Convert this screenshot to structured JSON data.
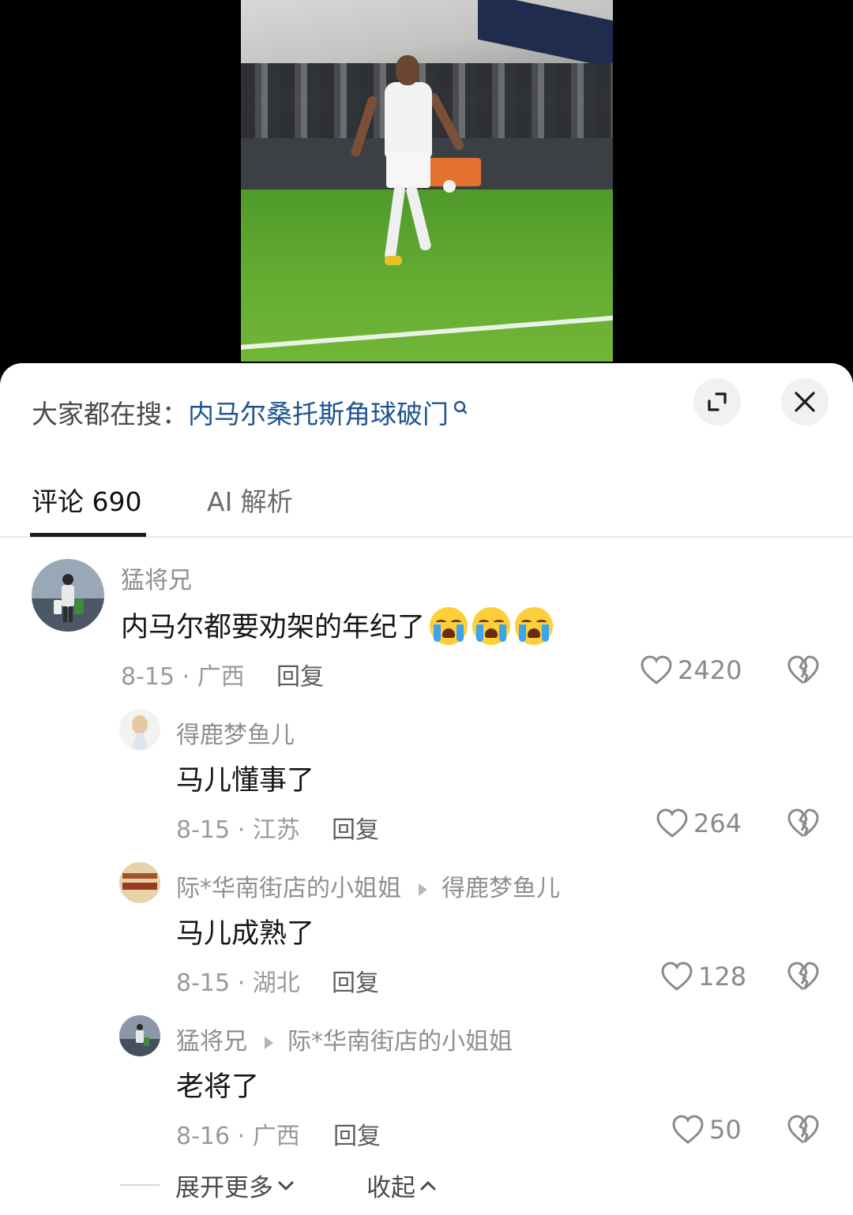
{
  "search": {
    "prefix": "大家都在搜：",
    "term": "内马尔桑托斯角球破门"
  },
  "tabs": [
    {
      "label": "评论 690"
    },
    {
      "label": "AI 解析"
    }
  ],
  "comments": [
    {
      "username": "猛将兄",
      "content": "内马尔都要劝架的年纪了",
      "emoji": "loudly-crying-face",
      "emoji_count": 3,
      "meta": "8-15 · 广西",
      "reply_label": "回复",
      "likes": "2420"
    },
    {
      "username": "得鹿梦鱼儿",
      "content": "马儿懂事了",
      "meta": "8-15 · 江苏",
      "reply_label": "回复",
      "likes": "264"
    },
    {
      "username": "际*华南街店的小姐姐",
      "reply_to": "得鹿梦鱼儿",
      "content": "马儿成熟了",
      "meta": "8-15 · 湖北",
      "reply_label": "回复",
      "likes": "128"
    },
    {
      "username": "猛将兄",
      "reply_to": "际*华南街店的小姐姐",
      "content": "老将了",
      "meta": "8-16 · 广西",
      "reply_label": "回复",
      "likes": "50"
    }
  ],
  "footer": {
    "expand_label": "展开更多",
    "collapse_label": "收起"
  },
  "colors": {
    "search_term": "#1e5490",
    "emoji_yellow": "#ffcf3a",
    "tear_blue": "#3ba4f2"
  }
}
